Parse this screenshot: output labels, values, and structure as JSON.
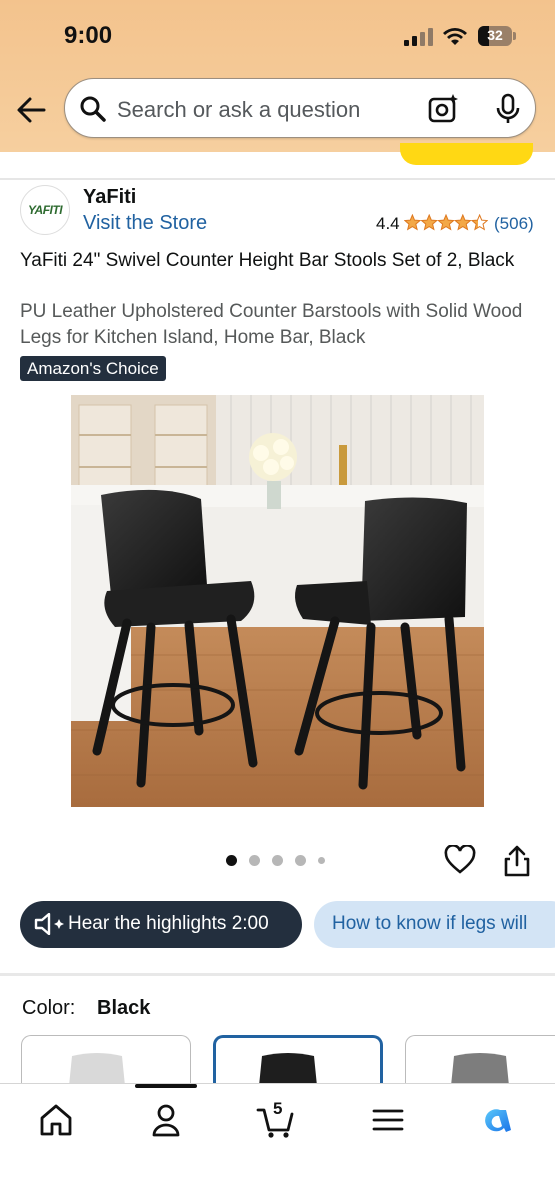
{
  "status_bar": {
    "time": "9:00",
    "battery": "32"
  },
  "search": {
    "placeholder": "Search or ask a question"
  },
  "store": {
    "logo_text": "YAFITI",
    "brand": "YaFiti",
    "visit_label": "Visit the Store",
    "rating": "4.4",
    "rating_stars": 4.4,
    "rating_count": "(506)"
  },
  "product": {
    "title": "YaFiti 24\" Swivel Counter Height Bar Stools Set of 2, Black",
    "subtitle": "PU Leather Upholstered Counter Barstools with Solid Wood Legs for Kitchen Island, Home Bar, Black",
    "badge": "Amazon's Choice"
  },
  "gallery": {
    "image_count": 5,
    "active_index": 0
  },
  "actions": {
    "hear_label": "Hear the highlights 2:00",
    "question_chip": "How to know if legs will"
  },
  "color": {
    "label": "Color:",
    "value": "Black",
    "options": [
      "Light Gray",
      "Black",
      "Gray"
    ]
  },
  "nav": {
    "cart_count": "5"
  },
  "colors": {
    "accent": "#2162a1",
    "badge": "#232f3e",
    "star": "#f3a847",
    "header": "#f3c38d",
    "buy": "#ffd814"
  }
}
